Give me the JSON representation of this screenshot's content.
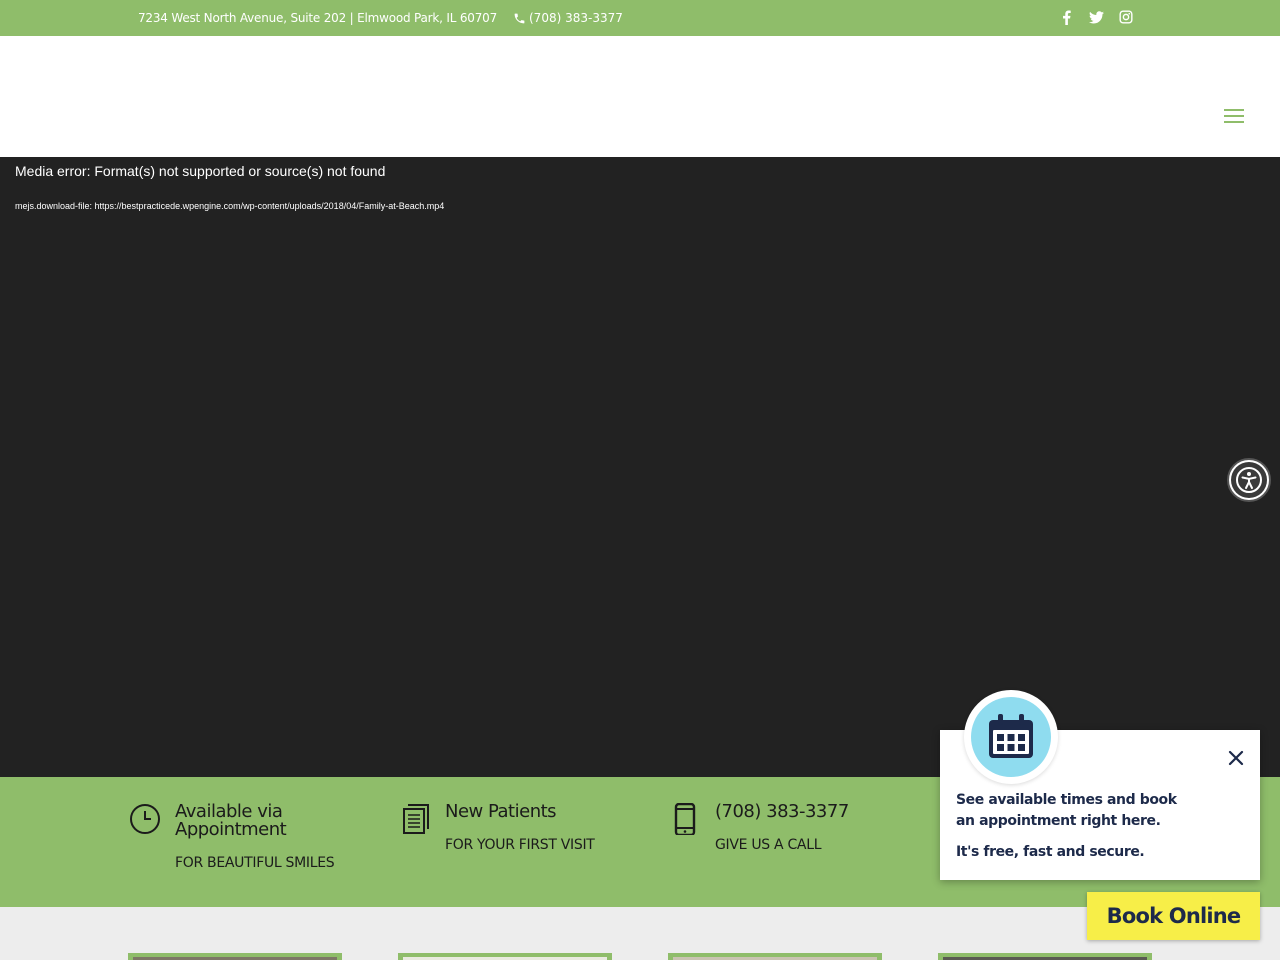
{
  "topbar": {
    "address": "7234 West North Avenue, Suite 202 | Elmwood Park, IL 60707",
    "phone": "(708) 383-3377",
    "social": [
      "facebook-icon",
      "twitter-icon",
      "instagram-icon"
    ]
  },
  "video": {
    "error": "Media error: Format(s) not supported or source(s) not found",
    "download": "mejs.download-file: https://bestpracticede.wpengine.com/wp-content/uploads/2018/04/Family-at-Beach.mp4"
  },
  "info": [
    {
      "icon": "clock-icon",
      "title": "Available via Appointment",
      "sub": "FOR BEAUTIFUL SMILES"
    },
    {
      "icon": "document-icon",
      "title": "New Patients",
      "sub": "FOR YOUR FIRST VISIT"
    },
    {
      "icon": "mobile-phone-icon",
      "title": "(708) 383-3377",
      "sub": "GIVE US A CALL"
    }
  ],
  "popup": {
    "line1": "See available times and book",
    "line2": "an appointment right here.",
    "line3": "It's free, fast and secure."
  },
  "book_button": "Book Online",
  "colors": {
    "brand_green": "#8fbd6a",
    "video_bg": "#222222",
    "book_yellow": "#f7ee48",
    "navy": "#1d2a4a"
  }
}
